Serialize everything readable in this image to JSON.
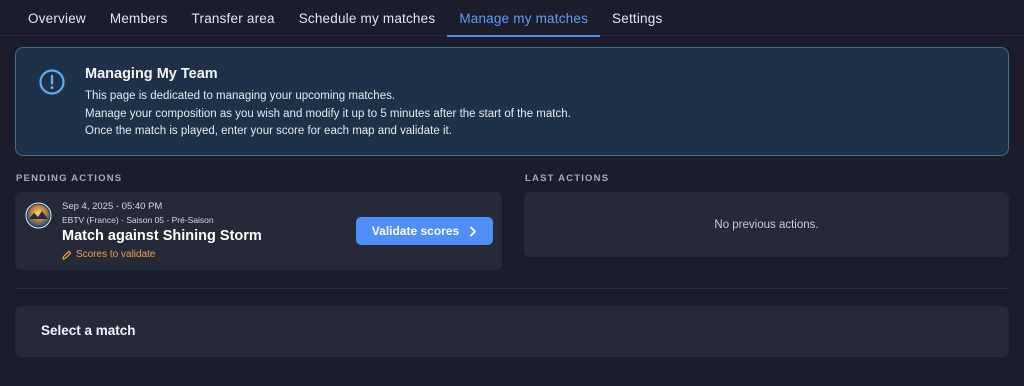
{
  "tabs": [
    {
      "label": "Overview",
      "active": false
    },
    {
      "label": "Members",
      "active": false
    },
    {
      "label": "Transfer area",
      "active": false
    },
    {
      "label": "Schedule my matches",
      "active": false
    },
    {
      "label": "Manage my matches",
      "active": true
    },
    {
      "label": "Settings",
      "active": false
    }
  ],
  "banner": {
    "icon": "info-icon",
    "title": "Managing My Team",
    "lines": [
      "This page is dedicated to managing your upcoming matches.",
      "Manage your composition as you wish and modify it up to 5 minutes after the start of the match.",
      "Once the match is played, enter your score for each map and validate it."
    ]
  },
  "pending": {
    "header": "PENDING ACTIONS",
    "match": {
      "date": "Sep 4, 2025 - 05:40 PM",
      "competition": "EBTV (France) - Saison 05 - Pré-Saison",
      "title": "Match against Shining Storm",
      "status": "Scores to validate",
      "button": "Validate scores"
    }
  },
  "last_actions": {
    "header": "LAST ACTIONS",
    "empty": "No previous actions."
  },
  "select_match": {
    "label": "Select a match"
  },
  "colors": {
    "background": "#1b1d2a",
    "accent": "#4f8ef7",
    "warning": "#f0a04b",
    "card": "#262938"
  }
}
